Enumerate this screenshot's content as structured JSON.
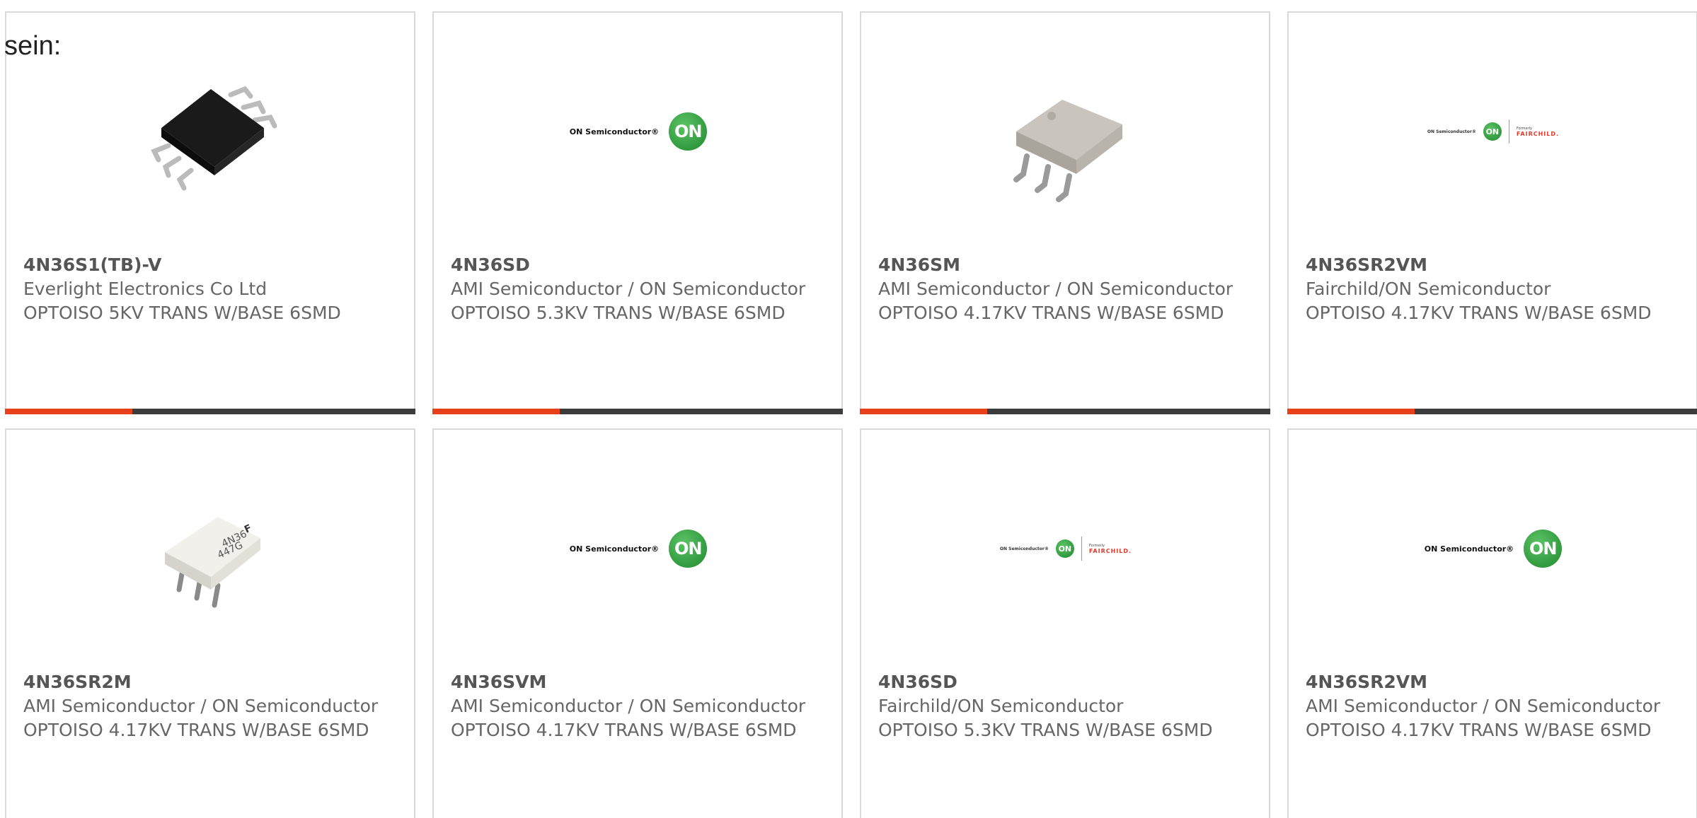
{
  "lead_text": "sein:",
  "colors": {
    "accent": "#e8401a",
    "bar_track": "#3c3c3c",
    "card_border": "#d9d9d9",
    "text": "#666666"
  },
  "progress_fraction": 0.31,
  "products": [
    {
      "part_number": "4N36S1(TB)-V",
      "manufacturer": "Everlight Electronics Co Ltd",
      "description": "OPTOISO 5KV TRANS W/BASE 6SMD",
      "image": "black-6smd-chip"
    },
    {
      "part_number": "4N36SD",
      "manufacturer": "AMI Semiconductor / ON Semiconductor",
      "description": "OPTOISO 5.3KV TRANS W/BASE 6SMD",
      "image": "on-semiconductor-logo"
    },
    {
      "part_number": "4N36SM",
      "manufacturer": "AMI Semiconductor / ON Semiconductor",
      "description": "OPTOISO 4.17KV TRANS W/BASE 6SMD",
      "image": "gray-6smd-chip"
    },
    {
      "part_number": "4N36SR2VM",
      "manufacturer": "Fairchild/ON Semiconductor",
      "description": "OPTOISO 4.17KV TRANS W/BASE 6SMD",
      "image": "on-fairchild-logo"
    },
    {
      "part_number": "4N36SR2M",
      "manufacturer": "AMI Semiconductor / ON Semiconductor",
      "description": "OPTOISO 4.17KV TRANS W/BASE 6SMD",
      "image": "white-6smd-chip"
    },
    {
      "part_number": "4N36SVM",
      "manufacturer": "AMI Semiconductor / ON Semiconductor",
      "description": "OPTOISO 4.17KV TRANS W/BASE 6SMD",
      "image": "on-semiconductor-logo"
    },
    {
      "part_number": "4N36SD",
      "manufacturer": "Fairchild/ON Semiconductor",
      "description": "OPTOISO 5.3KV TRANS W/BASE 6SMD",
      "image": "on-fairchild-logo"
    },
    {
      "part_number": "4N36SR2VM",
      "manufacturer": "AMI Semiconductor / ON Semiconductor",
      "description": "OPTOISO 4.17KV TRANS W/BASE 6SMD",
      "image": "on-semiconductor-logo"
    }
  ],
  "logos": {
    "on_wordmark": "ON Semiconductor®",
    "on_badge": "ON",
    "fairchild_formerly": "Formerly",
    "fairchild_word": "FAIRCHILD."
  }
}
